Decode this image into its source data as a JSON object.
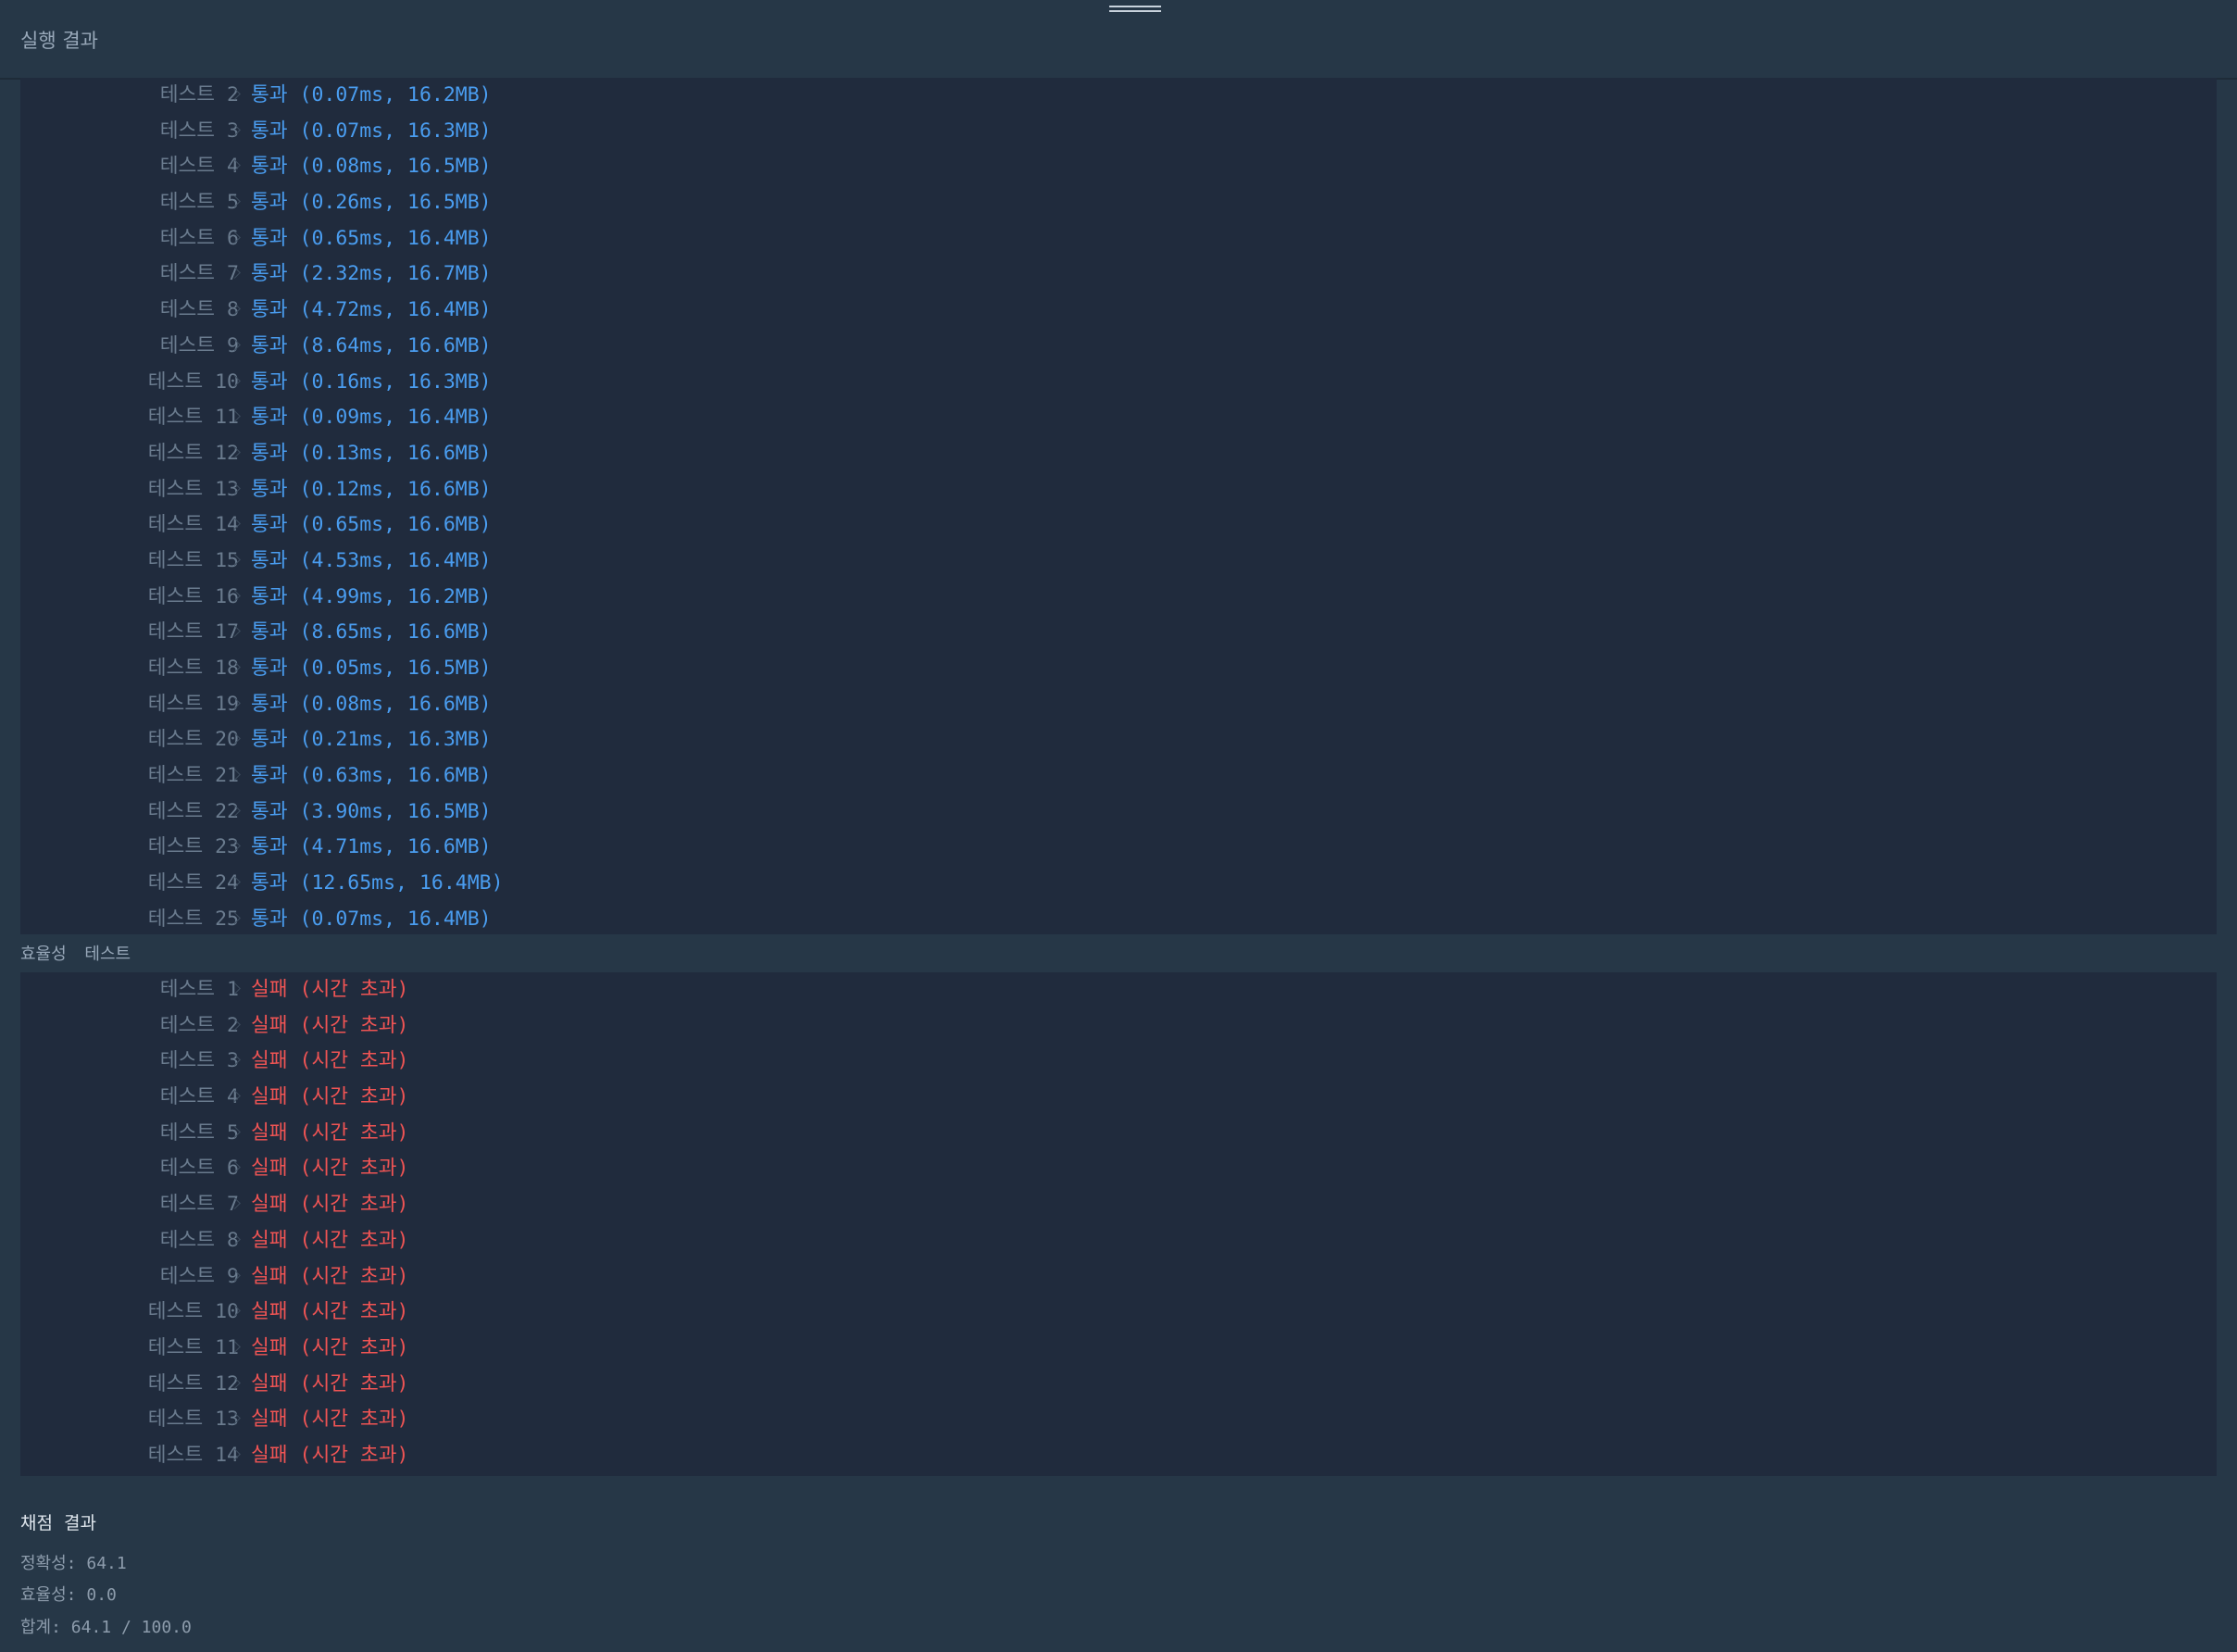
{
  "header": {
    "title": "실행 결과"
  },
  "accuracy": {
    "tests": [
      {
        "label": "테스트",
        "num": "2",
        "result": "통과 (0.07ms, 16.2MB)"
      },
      {
        "label": "테스트",
        "num": "3",
        "result": "통과 (0.07ms, 16.3MB)"
      },
      {
        "label": "테스트",
        "num": "4",
        "result": "통과 (0.08ms, 16.5MB)"
      },
      {
        "label": "테스트",
        "num": "5",
        "result": "통과 (0.26ms, 16.5MB)"
      },
      {
        "label": "테스트",
        "num": "6",
        "result": "통과 (0.65ms, 16.4MB)"
      },
      {
        "label": "테스트",
        "num": "7",
        "result": "통과 (2.32ms, 16.7MB)"
      },
      {
        "label": "테스트",
        "num": "8",
        "result": "통과 (4.72ms, 16.4MB)"
      },
      {
        "label": "테스트",
        "num": "9",
        "result": "통과 (8.64ms, 16.6MB)"
      },
      {
        "label": "테스트",
        "num": "10",
        "result": "통과 (0.16ms, 16.3MB)"
      },
      {
        "label": "테스트",
        "num": "11",
        "result": "통과 (0.09ms, 16.4MB)"
      },
      {
        "label": "테스트",
        "num": "12",
        "result": "통과 (0.13ms, 16.6MB)"
      },
      {
        "label": "테스트",
        "num": "13",
        "result": "통과 (0.12ms, 16.6MB)"
      },
      {
        "label": "테스트",
        "num": "14",
        "result": "통과 (0.65ms, 16.6MB)"
      },
      {
        "label": "테스트",
        "num": "15",
        "result": "통과 (4.53ms, 16.4MB)"
      },
      {
        "label": "테스트",
        "num": "16",
        "result": "통과 (4.99ms, 16.2MB)"
      },
      {
        "label": "테스트",
        "num": "17",
        "result": "통과 (8.65ms, 16.6MB)"
      },
      {
        "label": "테스트",
        "num": "18",
        "result": "통과 (0.05ms, 16.5MB)"
      },
      {
        "label": "테스트",
        "num": "19",
        "result": "통과 (0.08ms, 16.6MB)"
      },
      {
        "label": "테스트",
        "num": "20",
        "result": "통과 (0.21ms, 16.3MB)"
      },
      {
        "label": "테스트",
        "num": "21",
        "result": "통과 (0.63ms, 16.6MB)"
      },
      {
        "label": "테스트",
        "num": "22",
        "result": "통과 (3.90ms, 16.5MB)"
      },
      {
        "label": "테스트",
        "num": "23",
        "result": "통과 (4.71ms, 16.6MB)"
      },
      {
        "label": "테스트",
        "num": "24",
        "result": "통과 (12.65ms, 16.4MB)"
      },
      {
        "label": "테스트",
        "num": "25",
        "result": "통과 (0.07ms, 16.4MB)"
      }
    ]
  },
  "efficiency": {
    "title": "효율성 테스트",
    "tests": [
      {
        "label": "테스트",
        "num": "1",
        "result": "실패 (시간 초과)"
      },
      {
        "label": "테스트",
        "num": "2",
        "result": "실패 (시간 초과)"
      },
      {
        "label": "테스트",
        "num": "3",
        "result": "실패 (시간 초과)"
      },
      {
        "label": "테스트",
        "num": "4",
        "result": "실패 (시간 초과)"
      },
      {
        "label": "테스트",
        "num": "5",
        "result": "실패 (시간 초과)"
      },
      {
        "label": "테스트",
        "num": "6",
        "result": "실패 (시간 초과)"
      },
      {
        "label": "테스트",
        "num": "7",
        "result": "실패 (시간 초과)"
      },
      {
        "label": "테스트",
        "num": "8",
        "result": "실패 (시간 초과)"
      },
      {
        "label": "테스트",
        "num": "9",
        "result": "실패 (시간 초과)"
      },
      {
        "label": "테스트",
        "num": "10",
        "result": "실패 (시간 초과)"
      },
      {
        "label": "테스트",
        "num": "11",
        "result": "실패 (시간 초과)"
      },
      {
        "label": "테스트",
        "num": "12",
        "result": "실패 (시간 초과)"
      },
      {
        "label": "테스트",
        "num": "13",
        "result": "실패 (시간 초과)"
      },
      {
        "label": "테스트",
        "num": "14",
        "result": "실패 (시간 초과)"
      }
    ]
  },
  "summary": {
    "title": "채점 결과",
    "accuracy": "정확성: 64.1",
    "efficiency": "효율성: 0.0",
    "total": "합계: 64.1 / 100.0"
  },
  "colors": {
    "background": "#263747",
    "panel": "#202b3d",
    "pass": "#4a9df0",
    "fail": "#f05454",
    "label": "#6a7b8e"
  }
}
